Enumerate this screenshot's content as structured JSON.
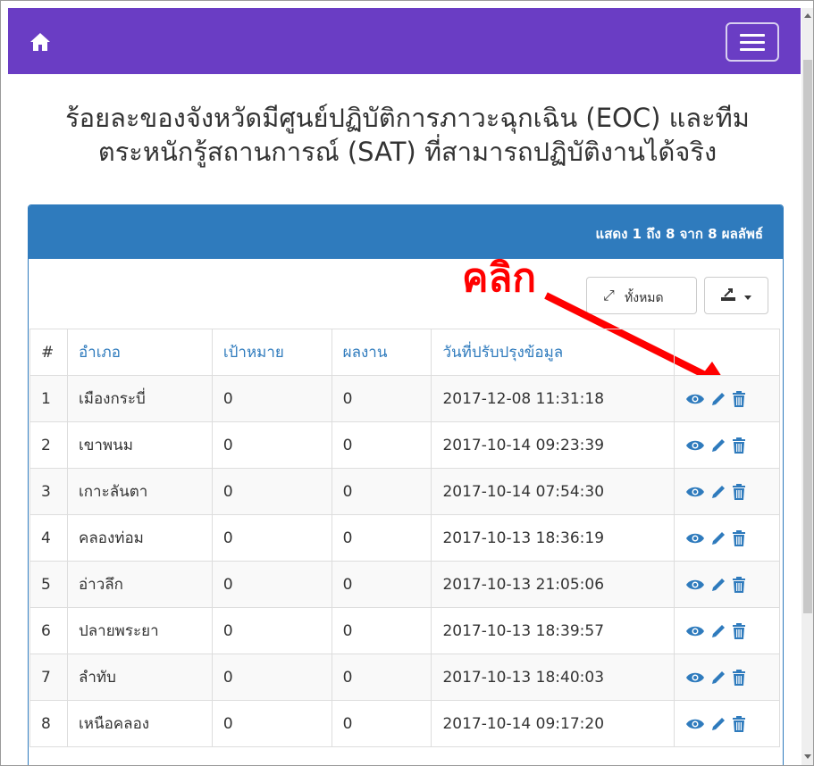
{
  "title": "ร้อยละของจังหวัดมีศูนย์ปฏิบัติการภาวะฉุกเฉิน (EOC) และทีมตระหนักรู้สถานการณ์ (SAT) ที่สามารถปฏิบัติงานได้จริง",
  "title_line1": "ร้อยละของจังหวัดมีศูนย์ปฏิบัติการภาวะฉุกเฉิน (EOC) และทีม",
  "title_line2": "ตระหนักรู้สถานการณ์ (SAT) ที่สามารถปฏิบัติงานได้จริง",
  "panel": {
    "summary": "แสดง 1 ถึง 8 จาก 8 ผลลัพธ์"
  },
  "toolbar": {
    "show_all_label": "ทั้งหมด",
    "export_icon": "export-icon"
  },
  "annotation": {
    "click_label": "คลิก"
  },
  "table": {
    "headers": [
      "#",
      "อำเภอ",
      "เป้าหมาย",
      "ผลงาน",
      "วันที่ปรับปรุงข้อมูล",
      ""
    ],
    "rows": [
      {
        "num": "1",
        "amphoe": "เมืองกระบี่",
        "target": "0",
        "result": "0",
        "updated": "2017-12-08 11:31:18"
      },
      {
        "num": "2",
        "amphoe": "เขาพนม",
        "target": "0",
        "result": "0",
        "updated": "2017-10-14 09:23:39"
      },
      {
        "num": "3",
        "amphoe": "เกาะลันตา",
        "target": "0",
        "result": "0",
        "updated": "2017-10-14 07:54:30"
      },
      {
        "num": "4",
        "amphoe": "คลองท่อม",
        "target": "0",
        "result": "0",
        "updated": "2017-10-13 18:36:19"
      },
      {
        "num": "5",
        "amphoe": "อ่าวลึก",
        "target": "0",
        "result": "0",
        "updated": "2017-10-13 21:05:06"
      },
      {
        "num": "6",
        "amphoe": "ปลายพระยา",
        "target": "0",
        "result": "0",
        "updated": "2017-10-13 18:39:57"
      },
      {
        "num": "7",
        "amphoe": "ลำทับ",
        "target": "0",
        "result": "0",
        "updated": "2017-10-13 18:40:03"
      },
      {
        "num": "8",
        "amphoe": "เหนือคลอง",
        "target": "0",
        "result": "0",
        "updated": "2017-10-14 09:17:20"
      }
    ]
  },
  "colors": {
    "navbar": "#6a3dc4",
    "panel_header": "#2f7bbd",
    "link": "#2f7bbd",
    "annotation": "#ff0000"
  }
}
